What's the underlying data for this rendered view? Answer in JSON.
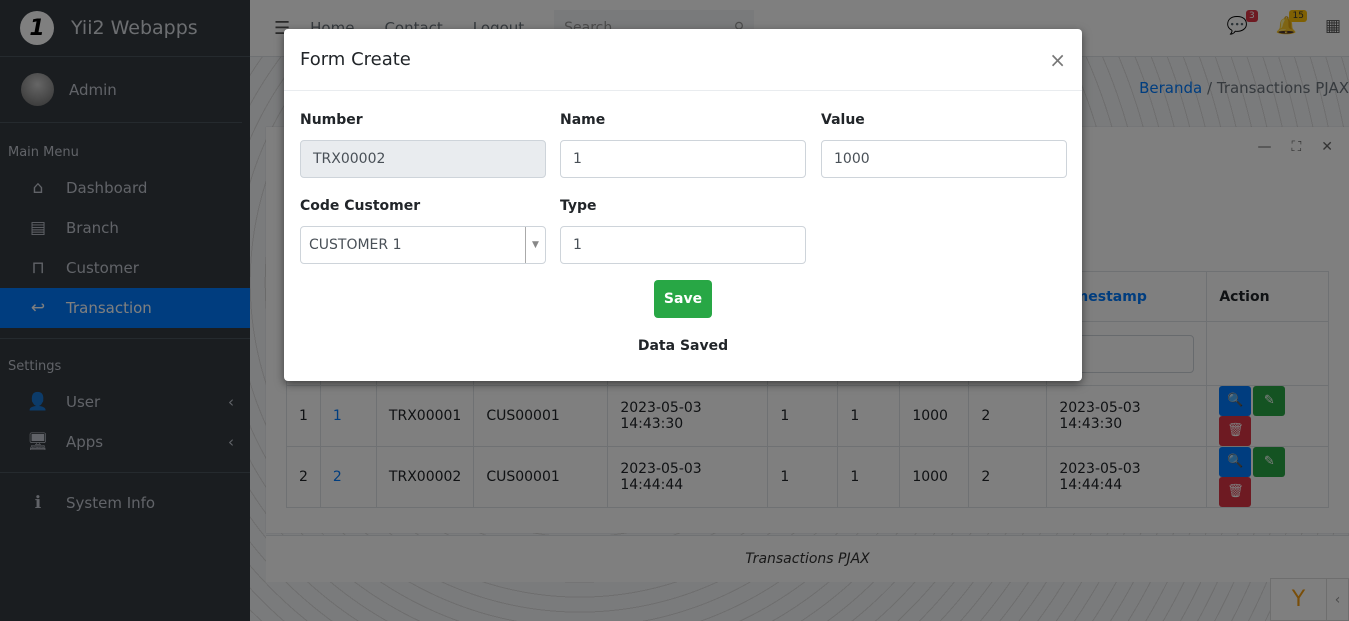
{
  "brand": {
    "logo": "1",
    "name": "Yii2 Webapps"
  },
  "user": {
    "name": "Admin"
  },
  "sidebar": {
    "main_menu": "Main Menu",
    "settings": "Settings",
    "items": [
      {
        "label": "Dashboard",
        "icon": "home-icon"
      },
      {
        "label": "Branch",
        "icon": "store-icon"
      },
      {
        "label": "Customer",
        "icon": "shop-icon"
      },
      {
        "label": "Transaction",
        "icon": "reply-icon",
        "active": true
      }
    ],
    "settings_items": [
      {
        "label": "User",
        "icon": "user-check-icon"
      },
      {
        "label": "Apps",
        "icon": "desktop-icon"
      }
    ],
    "system_info": "System Info"
  },
  "header": {
    "nav": [
      "Home",
      "Contact",
      "Logout"
    ],
    "search_placeholder": "Search",
    "messages_badge": "3",
    "notifications_badge": "15"
  },
  "breadcrumb": {
    "home": "Beranda",
    "sep": "/",
    "current": "Transactions PJAX"
  },
  "table": {
    "headers": [
      "",
      "",
      "",
      "",
      "",
      "",
      "",
      "",
      "",
      "Timestamp",
      "Action"
    ],
    "rows": [
      [
        "1",
        "1",
        "TRX00001",
        "CUS00001",
        "2023-05-03 14:43:30",
        "1",
        "1",
        "1000",
        "2",
        "2023-05-03 14:43:30"
      ],
      [
        "2",
        "2",
        "TRX00002",
        "CUS00001",
        "2023-05-03 14:44:44",
        "1",
        "1",
        "1000",
        "2",
        "2023-05-03 14:44:44"
      ]
    ]
  },
  "footer": "Transactions PJAX",
  "modal": {
    "title": "Form Create",
    "close": "×",
    "number_label": "Number",
    "number_value": "TRX00002",
    "name_label": "Name",
    "name_value": "1",
    "value_label": "Value",
    "value_value": "1000",
    "customer_label": "Code Customer",
    "customer_value": "CUSTOMER 1",
    "type_label": "Type",
    "type_value": "1",
    "save": "Save",
    "message": "Data Saved"
  },
  "colors": {
    "primary": "#007bff",
    "success": "#28a745",
    "danger": "#dc3545",
    "sidebar": "#343a40"
  }
}
